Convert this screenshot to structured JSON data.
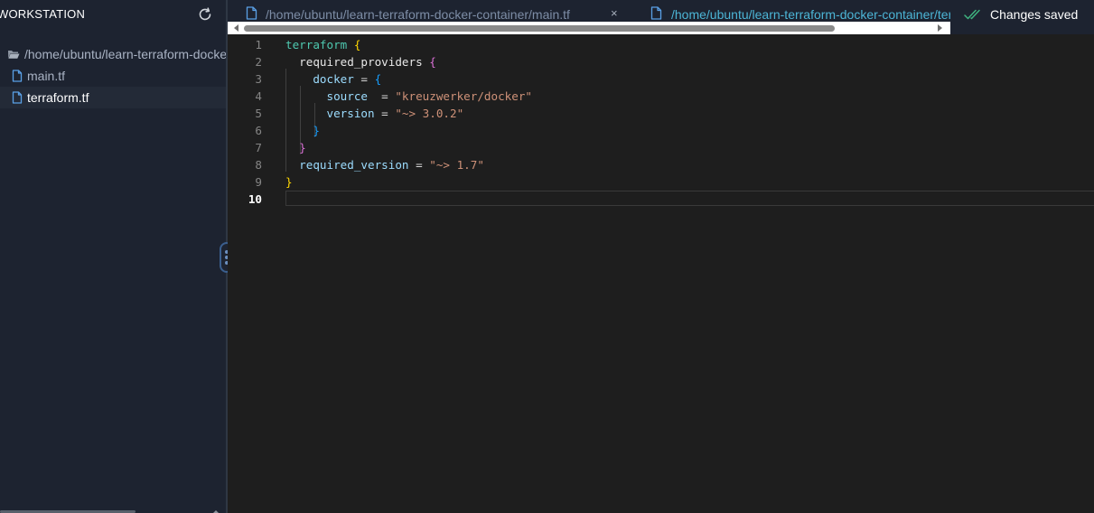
{
  "sidebar": {
    "title": "WORKSTATION",
    "tree": [
      {
        "label": "/home/ubuntu/learn-terraform-docker-container",
        "type": "folder"
      },
      {
        "label": "main.tf",
        "type": "file"
      },
      {
        "label": "terraform.tf",
        "type": "file",
        "selected": true
      }
    ]
  },
  "tabs": [
    {
      "label": "/home/ubuntu/learn-terraform-docker-container/main.tf",
      "close": "×"
    },
    {
      "label": "/home/ubuntu/learn-terraform-docker-container/terraform.tf"
    }
  ],
  "status": {
    "label": "Changes saved"
  },
  "editor": {
    "line_numbers": [
      "1",
      "2",
      "3",
      "4",
      "5",
      "6",
      "7",
      "8",
      "9",
      "10"
    ],
    "current_line": 10,
    "lines": [
      [
        {
          "t": "terraform",
          "c": "t-kw"
        },
        {
          "t": " "
        },
        {
          "t": "{",
          "c": "b1"
        }
      ],
      [
        {
          "t": "  "
        },
        {
          "t": "required_providers",
          "c": "t-id"
        },
        {
          "t": " "
        },
        {
          "t": "{",
          "c": "b2"
        }
      ],
      [
        {
          "t": "    "
        },
        {
          "t": "docker",
          "c": "t-prop"
        },
        {
          "t": " = ",
          "c": "t-op"
        },
        {
          "t": "{",
          "c": "b3"
        }
      ],
      [
        {
          "t": "      "
        },
        {
          "t": "source",
          "c": "t-prop"
        },
        {
          "t": "  = ",
          "c": "t-op"
        },
        {
          "t": "\"kreuzwerker/docker\"",
          "c": "t-str"
        }
      ],
      [
        {
          "t": "      "
        },
        {
          "t": "version",
          "c": "t-prop"
        },
        {
          "t": " = ",
          "c": "t-op"
        },
        {
          "t": "\"~> 3.0.2\"",
          "c": "t-str"
        }
      ],
      [
        {
          "t": "    "
        },
        {
          "t": "}",
          "c": "b3"
        }
      ],
      [
        {
          "t": "  "
        },
        {
          "t": "}",
          "c": "b2"
        }
      ],
      [
        {
          "t": "  "
        },
        {
          "t": "required_version",
          "c": "t-prop"
        },
        {
          "t": " = ",
          "c": "t-op"
        },
        {
          "t": "\"~> 1.7\"",
          "c": "t-str"
        }
      ],
      [
        {
          "t": "}",
          "c": "b1"
        }
      ],
      []
    ]
  },
  "colors": {
    "sidebar_bg": "#1d2330",
    "editor_bg": "#1e1e1e",
    "accent": "#4cb5d6",
    "file_icon": "#5aa0e6",
    "saved_check": "#3fb27f"
  },
  "icons": {
    "refresh": "refresh-icon",
    "folder": "folder-open-icon",
    "file": "file-icon",
    "close": "close-icon",
    "check": "double-check-icon"
  }
}
